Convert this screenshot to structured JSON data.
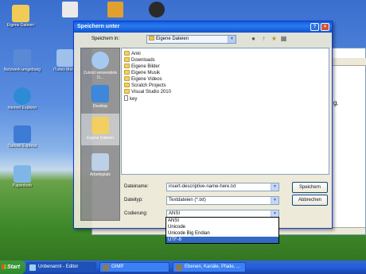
{
  "desktop": {
    "icons": [
      {
        "label": "Eigene Dateien"
      },
      {
        "label": "Netzwerk-umgebung"
      },
      {
        "label": "iTunes Media"
      },
      {
        "label": "Internet Explorer"
      },
      {
        "label": "Outlook Express"
      },
      {
        "label": "Papierkorb"
      }
    ]
  },
  "editor_fragment": "g.",
  "dialog": {
    "title": "Speichern unter",
    "help_glyph": "?",
    "close_glyph": "×",
    "save_in_label": "Speichern in:",
    "save_in_value": "Eigene Dateien",
    "places": [
      {
        "label": "Zuletzt verwendete D..."
      },
      {
        "label": "Desktop"
      },
      {
        "label": "Eigene Dateien"
      },
      {
        "label": "Arbeitsplatz"
      }
    ],
    "files": [
      {
        "name": "Anki",
        "type": "folder"
      },
      {
        "name": "Downloads",
        "type": "folder"
      },
      {
        "name": "Eigene Bilder",
        "type": "folder"
      },
      {
        "name": "Eigene Musik",
        "type": "folder"
      },
      {
        "name": "Eigene Videos",
        "type": "folder"
      },
      {
        "name": "Scratch Projects",
        "type": "folder"
      },
      {
        "name": "Visual Studio 2010",
        "type": "folder"
      },
      {
        "name": "key",
        "type": "file"
      }
    ],
    "filename_label": "Dateiname:",
    "filename_value": "insert-descriptive-name-here.txt",
    "filetype_label": "Dateityp:",
    "filetype_value": "Textdateien (*.txt)",
    "encoding_label": "Codierung:",
    "encoding_value": "ANSI",
    "encoding_options": [
      {
        "label": "ANSI",
        "selected": false
      },
      {
        "label": "Unicode",
        "selected": false
      },
      {
        "label": "Unicode Big Endian",
        "selected": false
      },
      {
        "label": "UTF-8",
        "selected": true
      }
    ],
    "save_button": "Speichern",
    "cancel_button": "Abbrechen"
  },
  "taskbar": {
    "start_label": "Start",
    "tasks": [
      {
        "label": "Unbenannt - Editor",
        "active": true
      },
      {
        "label": "GIMP",
        "active": false
      },
      {
        "label": "Ebenen, Kanäle, Pfade, ...",
        "active": false
      }
    ]
  },
  "colors": {
    "accent": "#0a5ce6",
    "selection": "#316ac5",
    "folder": "#f0cc57"
  }
}
